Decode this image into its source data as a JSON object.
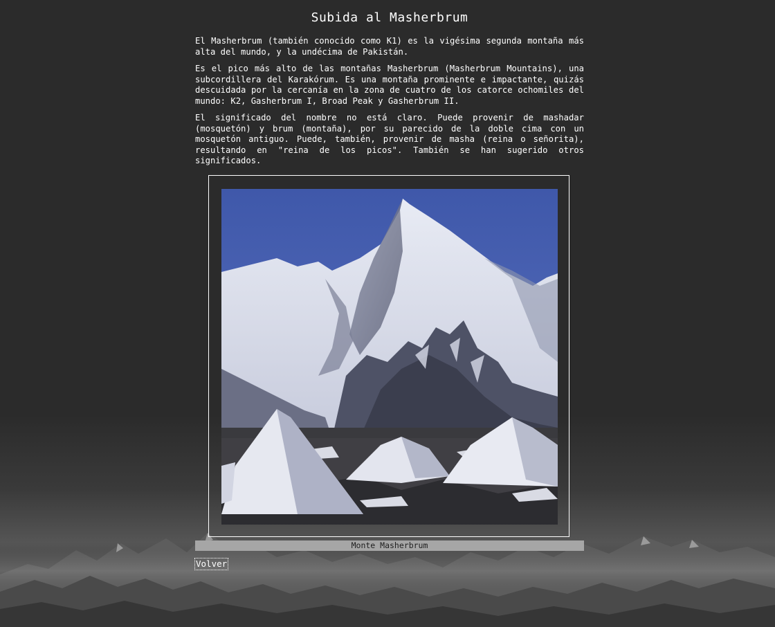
{
  "page": {
    "title": "Subida al Masherbrum",
    "paragraphs": [
      "El Masherbrum (también conocido como K1) es la vigésima segunda montaña más alta del mundo, y la undécima de Pakistán.",
      "Es el pico más alto de las montañas Masherbrum (Masherbrum Mountains), una subcordillera del Karakórum. Es una montaña prominente e impactante, quizás descuidada por la cercanía en la zona de cuatro de los catorce ochomiles del mundo: K2, Gasherbrum I, Broad Peak y Gasherbrum II.",
      "El significado del nombre no está claro. Puede provenir de mashadar (mosquetón) y brum (montaña), por su parecido de la doble cima con un mosquetón antiguo. Puede, también, provenir de masha (reina o señorita), resultando en \"reina de los picos\". También se han sugerido otros significados."
    ],
    "figure": {
      "caption": "Monte Masherbrum"
    },
    "back_link": "Volver"
  },
  "colors": {
    "background": "#2b2b2b",
    "text": "#ffffff",
    "caption_bar": "#a6a6a6",
    "caption_text": "#1e1e1e",
    "sky": "#4a63b3"
  }
}
